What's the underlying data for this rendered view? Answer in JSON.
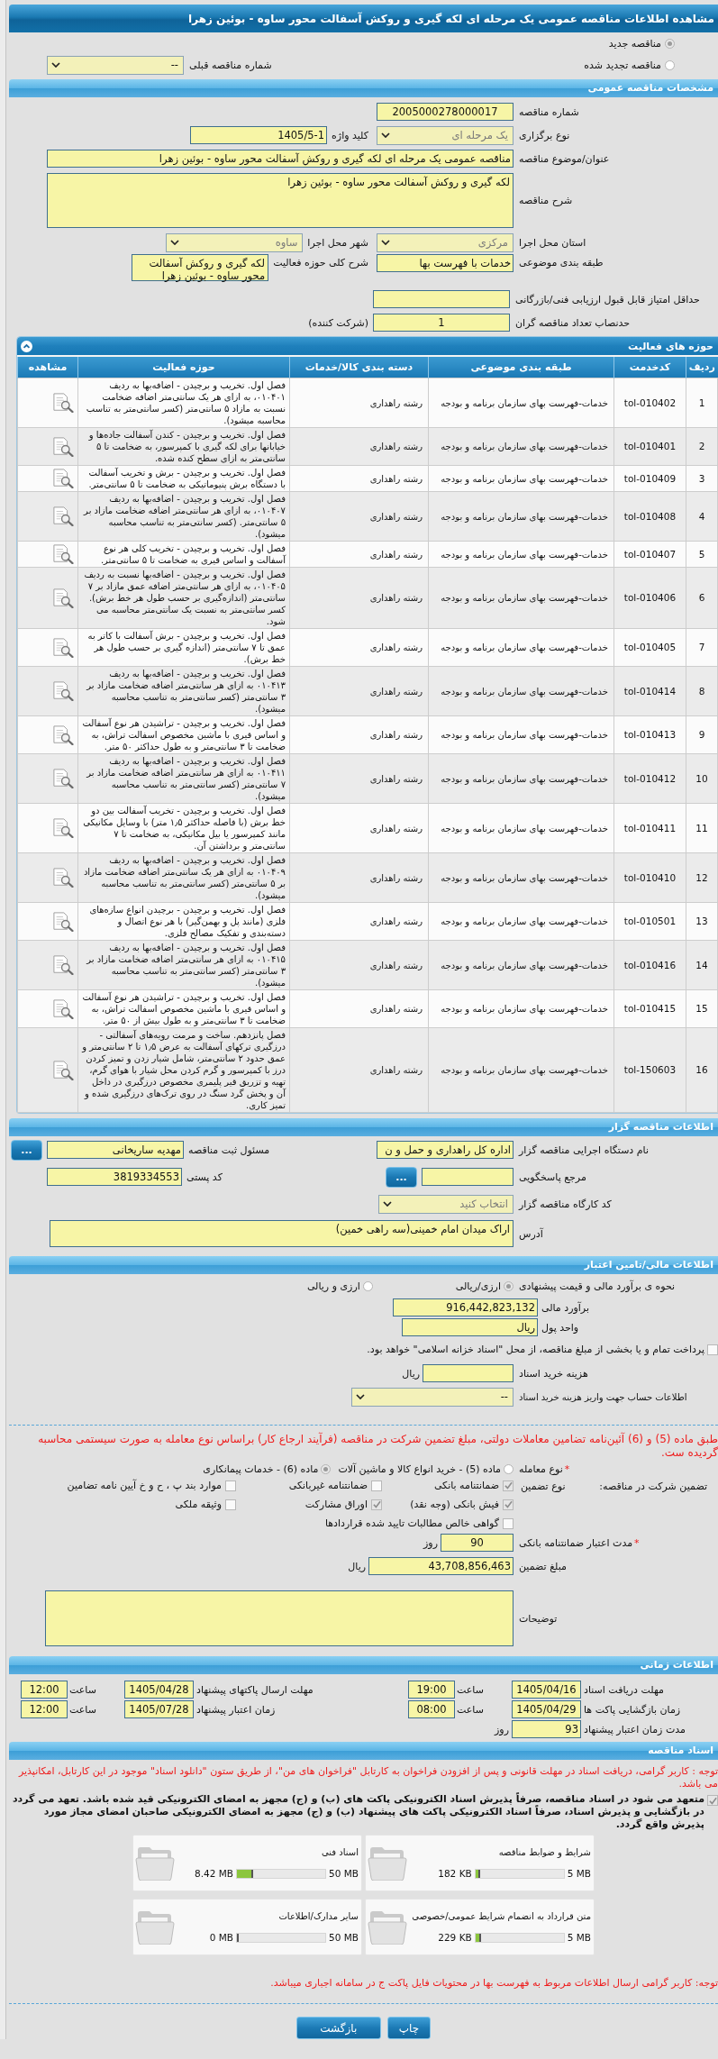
{
  "title": "مشاهده اطلاعات مناقصه عمومی یک مرحله ای لکه گیری و روکش آسفالت محور ساوه - بوئین زهرا",
  "tender_status": {
    "options": [
      {
        "label": "مناقصه جدید",
        "selected": true
      },
      {
        "label": "مناقصه تجدید شده",
        "selected": false
      }
    ],
    "previous": {
      "label": "شماره مناقصه قبلی",
      "value": "--",
      "disabled": false
    }
  },
  "general": {
    "title": "مشخصات مناقصه عمومی",
    "tender_number": {
      "label": "شماره مناقصه",
      "value": "2005000278000017"
    },
    "holding_type": {
      "label": "نوع برگزاری",
      "value": "یک مرحله ای",
      "disabled": true
    },
    "keyword": {
      "label": "کلید واژه",
      "value": "1405/5-1"
    },
    "subject": {
      "label": "عنوان/موضوع مناقصه",
      "value": "مناقصه عمومی یک مرحله ای لکه گیری و روکش آسفالت محور ساوه - بوئین زهرا"
    },
    "description": {
      "label": "شرح مناقصه",
      "value": "لکه گیری و روکش آسفالت محور ساوه - بوئین زهرا"
    },
    "province": {
      "label": "استان محل اجرا",
      "value": "مرکزی",
      "disabled": true
    },
    "city": {
      "label": "شهر محل اجرا",
      "value": "ساوه",
      "disabled": true
    },
    "classification": {
      "label": "طبقه بندی موضوعی",
      "value": "خدمات با فهرست بها"
    },
    "activity_summary": {
      "label": "شرح کلی حوزه فعالیت",
      "value": "لکه گیری و روکش آسفالت محور ساوه - بوئین زهرا"
    },
    "min_score": {
      "label": "حداقل امتیاز قابل قبول ارزیابی فنی/بازرگانی"
    },
    "min_bidders": {
      "label": "حدنصاب تعداد مناقصه گران",
      "value": "1",
      "unit": "(شرکت کننده)"
    }
  },
  "activities": {
    "title": "حوزه های فعالیت",
    "columns": [
      "ردیف",
      "کدخدمت",
      "طبقه بندی موضوعی",
      "دسته بندی کالا/خدمات",
      "حوزه فعالیت",
      "مشاهده"
    ],
    "rows": [
      {
        "index": "1",
        "code": "tol-010402",
        "classification": "خدمات-فهرست بهای سازمان برنامه و بودجه",
        "category": "رشته راهداری",
        "activity": "فصل اول. تخریب و برچیدن - اضافه‌بها به ردیف ۰۱۰۴۰۱، به ازای هر یک سانتی‌متر اضافه ضخامت نسبت به مازاد ۵ سانتی‌متر (کسر سانتی‌متر به تناسب محاسبه میشود)."
      },
      {
        "index": "2",
        "code": "tol-010401",
        "classification": "خدمات-فهرست بهای سازمان برنامه و بودجه",
        "category": "رشته راهداری",
        "activity": "فصل اول. تخریب و برچیدن - کندن آسفالت جاده‌ها و خیابانها برای لکه گیری با کمپرسور، به ضخامت تا ۵ سانتی‌متر به ازای سطح کنده شده."
      },
      {
        "index": "3",
        "code": "tol-010409",
        "classification": "خدمات-فهرست بهای سازمان برنامه و بودجه",
        "category": "رشته راهداری",
        "activity": "فصل اول. تخریب و برچیدن - برش و تخریب آسفالت با دستگاه برش پنیوماتیکی به ضخامت تا ۵ سانتی‌متر."
      },
      {
        "index": "4",
        "code": "tol-010408",
        "classification": "خدمات-فهرست بهای سازمان برنامه و بودجه",
        "category": "رشته راهداری",
        "activity": "فصل اول. تخریب و برچیدن - اضافه‌بها به ردیف ۰۱۰۴۰۷، به ازای هر سانتی‌متر اضافه ضخامت مازاد بر ۵ سانتی‌متر. (کسر سانتی‌متر به تناسب محاسبه میشود)."
      },
      {
        "index": "5",
        "code": "tol-010407",
        "classification": "خدمات-فهرست بهای سازمان برنامه و بودجه",
        "category": "رشته راهداری",
        "activity": "فصل اول. تخریب و برچیدن - تخریب کلی هر نوع آسفالت و اساس قیری به ضخامت تا ۵ سانتی‌متر."
      },
      {
        "index": "6",
        "code": "tol-010406",
        "classification": "خدمات-فهرست بهای سازمان برنامه و بودجه",
        "category": "رشته راهداری",
        "activity": "فصل اول. تخریب و برچیدن - اضافه‌بها نسبت به ردیف ۰۱۰۴۰۵، به ازای هر سانتی‌متر اضافه عمق مازاد بر ۷ سانتی‌متر (اندازه‌گیری بر حسب طول هر خط برش). کسر سانتی‌متر به نسبت یک سانتی‌متر محاسبه می شود."
      },
      {
        "index": "7",
        "code": "tol-010405",
        "classification": "خدمات-فهرست بهای سازمان برنامه و بودجه",
        "category": "رشته راهداری",
        "activity": "فصل اول. تخریب و برچیدن - برش آسفالت با کاتر به عمق تا ۷ سانتی‌متر (اندازه گیری بر حسب طول هر خط برش)."
      },
      {
        "index": "8",
        "code": "tol-010414",
        "classification": "خدمات-فهرست بهای سازمان برنامه و بودجه",
        "category": "رشته راهداری",
        "activity": "فصل اول. تخریب و برچیدن - اضافه‌بها به ردیف ۰۱۰۴۱۳ به ازای هر سانتی‌متر اضافه ضخامت مازاد بر ۳ سانتی‌متر (کسر سانتی‌متر به تناسب محاسبه میشود)."
      },
      {
        "index": "9",
        "code": "tol-010413",
        "classification": "خدمات-فهرست بهای سازمان برنامه و بودجه",
        "category": "رشته راهداری",
        "activity": "فصل اول. تخریب و برچیدن - تراشیدن هر نوع آسفالت و اساس قیری با ماشین مخصوص اسفالت تراش، به ضخامت تا ۳ سانتی‌متر و به طول حداکثر ۵۰ متر."
      },
      {
        "index": "10",
        "code": "tol-010412",
        "classification": "خدمات-فهرست بهای سازمان برنامه و بودجه",
        "category": "رشته راهداری",
        "activity": "فصل اول. تخریب و برچیدن - اضافه‌بها به ردیف ۰۱۰۴۱۱ به ازای هر سانتی‌متر اضافه ضخامت مازاد بر ۷ سانتی‌متر (کسر سانتی‌متر به تناسب محاسبه میشود)."
      },
      {
        "index": "11",
        "code": "tol-010411",
        "classification": "خدمات-فهرست بهای سازمان برنامه و بودجه",
        "category": "رشته راهداری",
        "activity": "فصل اول. تخریب و برچیدن - تخریب آسفالت بین دو خط برش (با فاصله حداکثر ۱٫۵ متر) با وسایل مکانیکی مانند کمپرسور یا بیل مکانیکی، به ضخامت تا ۷ سانتی‌متر و برداشتن آن."
      },
      {
        "index": "12",
        "code": "tol-010410",
        "classification": "خدمات-فهرست بهای سازمان برنامه و بودجه",
        "category": "رشته راهداری",
        "activity": "فصل اول. تخریب و برچیدن - اضافه‌بها به ردیف ۰۱۰۴۰۹ به ازای هر یک سانتی‌متر اضافه ضخامت مازاد بر ۵ سانتی‌متر (کسر سانتی‌متر به تناسب محاسبه میشود)."
      },
      {
        "index": "13",
        "code": "tol-010501",
        "classification": "خدمات-فهرست بهای سازمان برنامه و بودجه",
        "category": "رشته راهداری",
        "activity": "فصل اول. تخریب و برچیدن - برچیدن انواع سازه‌های فلزی (مانند پل و بهمن‌گیر) با هر نوع اتصال و دسته‌بندی و تفکیک مصالح فلزی."
      },
      {
        "index": "14",
        "code": "tol-010416",
        "classification": "خدمات-فهرست بهای سازمان برنامه و بودجه",
        "category": "رشته راهداری",
        "activity": "فصل اول. تخریب و برچیدن - اضافه‌بها به ردیف ۰۱۰۴۱۵ به ازای هر سانتی‌متر اضافه ضخامت مازاد بر ۳ سانتی‌متر (کسر سانتی‌متر به تناسب محاسبه میشود)."
      },
      {
        "index": "15",
        "code": "tol-010415",
        "classification": "خدمات-فهرست بهای سازمان برنامه و بودجه",
        "category": "رشته راهداری",
        "activity": "فصل اول. تخریب و برچیدن - تراشیدن هر نوع آسفالت و اساس قیری با ماشین مخصوص اسفالت تراش، به ضخامت تا ۳ سانتی‌متر و به طول بیش از ۵۰ متر."
      },
      {
        "index": "16",
        "code": "tol-150603",
        "classification": "خدمات-فهرست بهای سازمان برنامه و بودجه",
        "category": "رشته راهداری",
        "activity": "فصل پانزدهم. ساخت و مرمت رویه‌های آسفالتی - درزگیری ترکهای آسفالت به عرض ۱٫۵ تا ۲ سانتی‌متر و عمق حدود ۲ سانتی‌متر، شامل شیار زدن و تمیز کردن درز با کمپرسور و گرم کردن محل شیار با هوای گرم، تهیه و تزریق قیر پلیمری مخصوص درزگیری در داخل آن و پخش گرد سنگ در روی ترک‌های درزگیری شده و تمیز کاری."
      }
    ]
  },
  "tenderer": {
    "title": "اطلاعات مناقصه گزار",
    "agency": {
      "label": "نام دستگاه اجرایی مناقصه گزار",
      "value": "اداره کل راهداری و حمل و ن"
    },
    "registrar": {
      "label": "مسئول ثبت مناقصه",
      "value": "مهدیه ساریخانی",
      "button": "..."
    },
    "contact_ref": {
      "label": "مرجع پاسخگویی",
      "button": "..."
    },
    "postal_code": {
      "label": "کد پستی",
      "value": "3819334553"
    },
    "workshop_code": {
      "label": "کد کارگاه مناقصه گزار",
      "value": "انتخاب کنید",
      "disabled": true
    },
    "address": {
      "label": "آدرس",
      "value": "اراک میدان امام خمینی(سه راهی خمین)"
    }
  },
  "finance": {
    "title": "اطلاعات مالی/تامین اعتبار",
    "estimate_method": {
      "label": "نحوه ی برآورد مالی و قیمت پیشنهادی",
      "options": [
        {
          "label": "ارزی/ریالی",
          "selected": true
        },
        {
          "label": "ارزی و ریالی",
          "selected": false
        }
      ]
    },
    "estimate": {
      "label": "برآورد مالی",
      "value": "916,442,823,132"
    },
    "currency": {
      "label": "واحد پول",
      "value": "ریال"
    },
    "treasury": {
      "label": "پرداخت تمام و یا بخشی از مبلغ مناقصه، از محل \"اسناد خزانه اسلامی\" خواهد بود.",
      "checked": false
    },
    "doc_fee": {
      "label": "هزینه خرید اسناد",
      "unit": "ریال"
    },
    "account": {
      "label": "اطلاعات حساب جهت واریز هزینه خرید اسناد",
      "value": "--",
      "disabled": false
    },
    "guarantee_note": "طبق ماده (5) و (6) آئین‌نامه تضامین معاملات دولتی، مبلغ تضمین شرکت در مناقصه (فرآیند ارجاع کار) براساس نوع معامله به صورت سیستمی محاسبه گردیده ست.",
    "deal_type": {
      "mark": "*",
      "label": "نوع معامله",
      "options": [
        {
          "label": "ماده (5) - خرید انواع کالا و ماشین آلات",
          "selected": false
        },
        {
          "label": "ماده (6) - خدمات پیمانکاری",
          "selected": true
        }
      ]
    },
    "guarantee": {
      "label": "تضمین شرکت در مناقصه:",
      "type_label": "نوع تضمین",
      "options": [
        {
          "label": "ضمانتنامه بانکی",
          "checked": true
        },
        {
          "label": "ضمانتنامه غیربانکی",
          "checked": false
        },
        {
          "label": "موارد بند پ ، ح و خ آیین نامه تضامین",
          "checked": false
        },
        {
          "label": "فیش بانکی (وجه نقد)",
          "checked": true
        },
        {
          "label": "اوراق مشارکت",
          "checked": true
        },
        {
          "label": "وثیقه ملکی",
          "checked": false
        },
        {
          "label": "گواهی خالص مطالبات تایید شده قراردادها",
          "checked": false
        }
      ]
    },
    "validity": {
      "mark": "*",
      "label": "مدت اعتبار ضمانتنامه بانکی",
      "value": "90",
      "unit": "روز"
    },
    "amount": {
      "label": "مبلغ تضمین",
      "value": "43,708,856,463",
      "unit": "ریال"
    },
    "notes": {
      "label": "توضیحات"
    }
  },
  "timing": {
    "title": "اطلاعات زمانی",
    "entries": [
      {
        "label": "مهلت دریافت اسناد",
        "date": "1405/04/16",
        "time_label": "ساعت",
        "time": "19:00"
      },
      {
        "label": "مهلت ارسال پاکتهای پیشنهاد",
        "date": "1405/04/28",
        "time_label": "ساعت",
        "time": "12:00"
      },
      {
        "label": "زمان بازگشایی پاکت ها",
        "date": "1405/04/29",
        "time_label": "ساعت",
        "time": "08:00"
      },
      {
        "label": "زمان اعتبار پیشنهاد",
        "date": "1405/07/28",
        "time_label": "ساعت",
        "time": "12:00"
      }
    ],
    "validity_days": {
      "label": "مدت زمان اعتبار پیشنهاد",
      "value": "93",
      "unit": "روز"
    }
  },
  "documents": {
    "title": "اسناد مناقصه",
    "notice": "توجه : کاربر گرامی، دریافت اسناد در مهلت قانونی و پس از افزودن فراخوان به کارتابل \"فراخوان های من\"، از طریق ستون \"دانلود اسناد\" موجود در این کارتابل، امکانپذیر می باشد.",
    "commitment": {
      "text": "متعهد می شود در اسناد مناقصه، صرفاً پذیرش اسناد الکترونیکی پاکت های (ب) و (ج) مجهز به امضای الکترونیکی قید شده باشد. تعهد می گردد در بازگشایی و پذیرش اسناد، صرفاً اسناد الکترونیکی پاکت های پیشنهاد (ب) و (ج) مجهز به امضای الکترونیکی صاحبان امضای مجاز مورد پذیرش واقع گردد.",
      "checked": true
    },
    "files": [
      {
        "title": "شرایط و ضوابط مناقصه",
        "max": "5 MB",
        "used": "182 KB",
        "level": 0.036
      },
      {
        "title": "اسناد فنی",
        "max": "50 MB",
        "used": "8.42 MB",
        "level": 0.168
      },
      {
        "title": "متن قرارداد به انضمام شرایط عمومی/خصوصی",
        "max": "5 MB",
        "used": "229 KB",
        "level": 0.045
      },
      {
        "title": "سایر مدارک/اطلاعات",
        "max": "50 MB",
        "used": "0 MB",
        "level": 0
      }
    ],
    "footer_note": "توجه: کاربر گرامی ارسال اطلاعات مربوط به فهرست بها در محتویات فایل پاکت ج در سامانه اجباری میباشد."
  },
  "buttons": [
    {
      "label": "چاپ"
    },
    {
      "label": "بازگشت"
    }
  ]
}
